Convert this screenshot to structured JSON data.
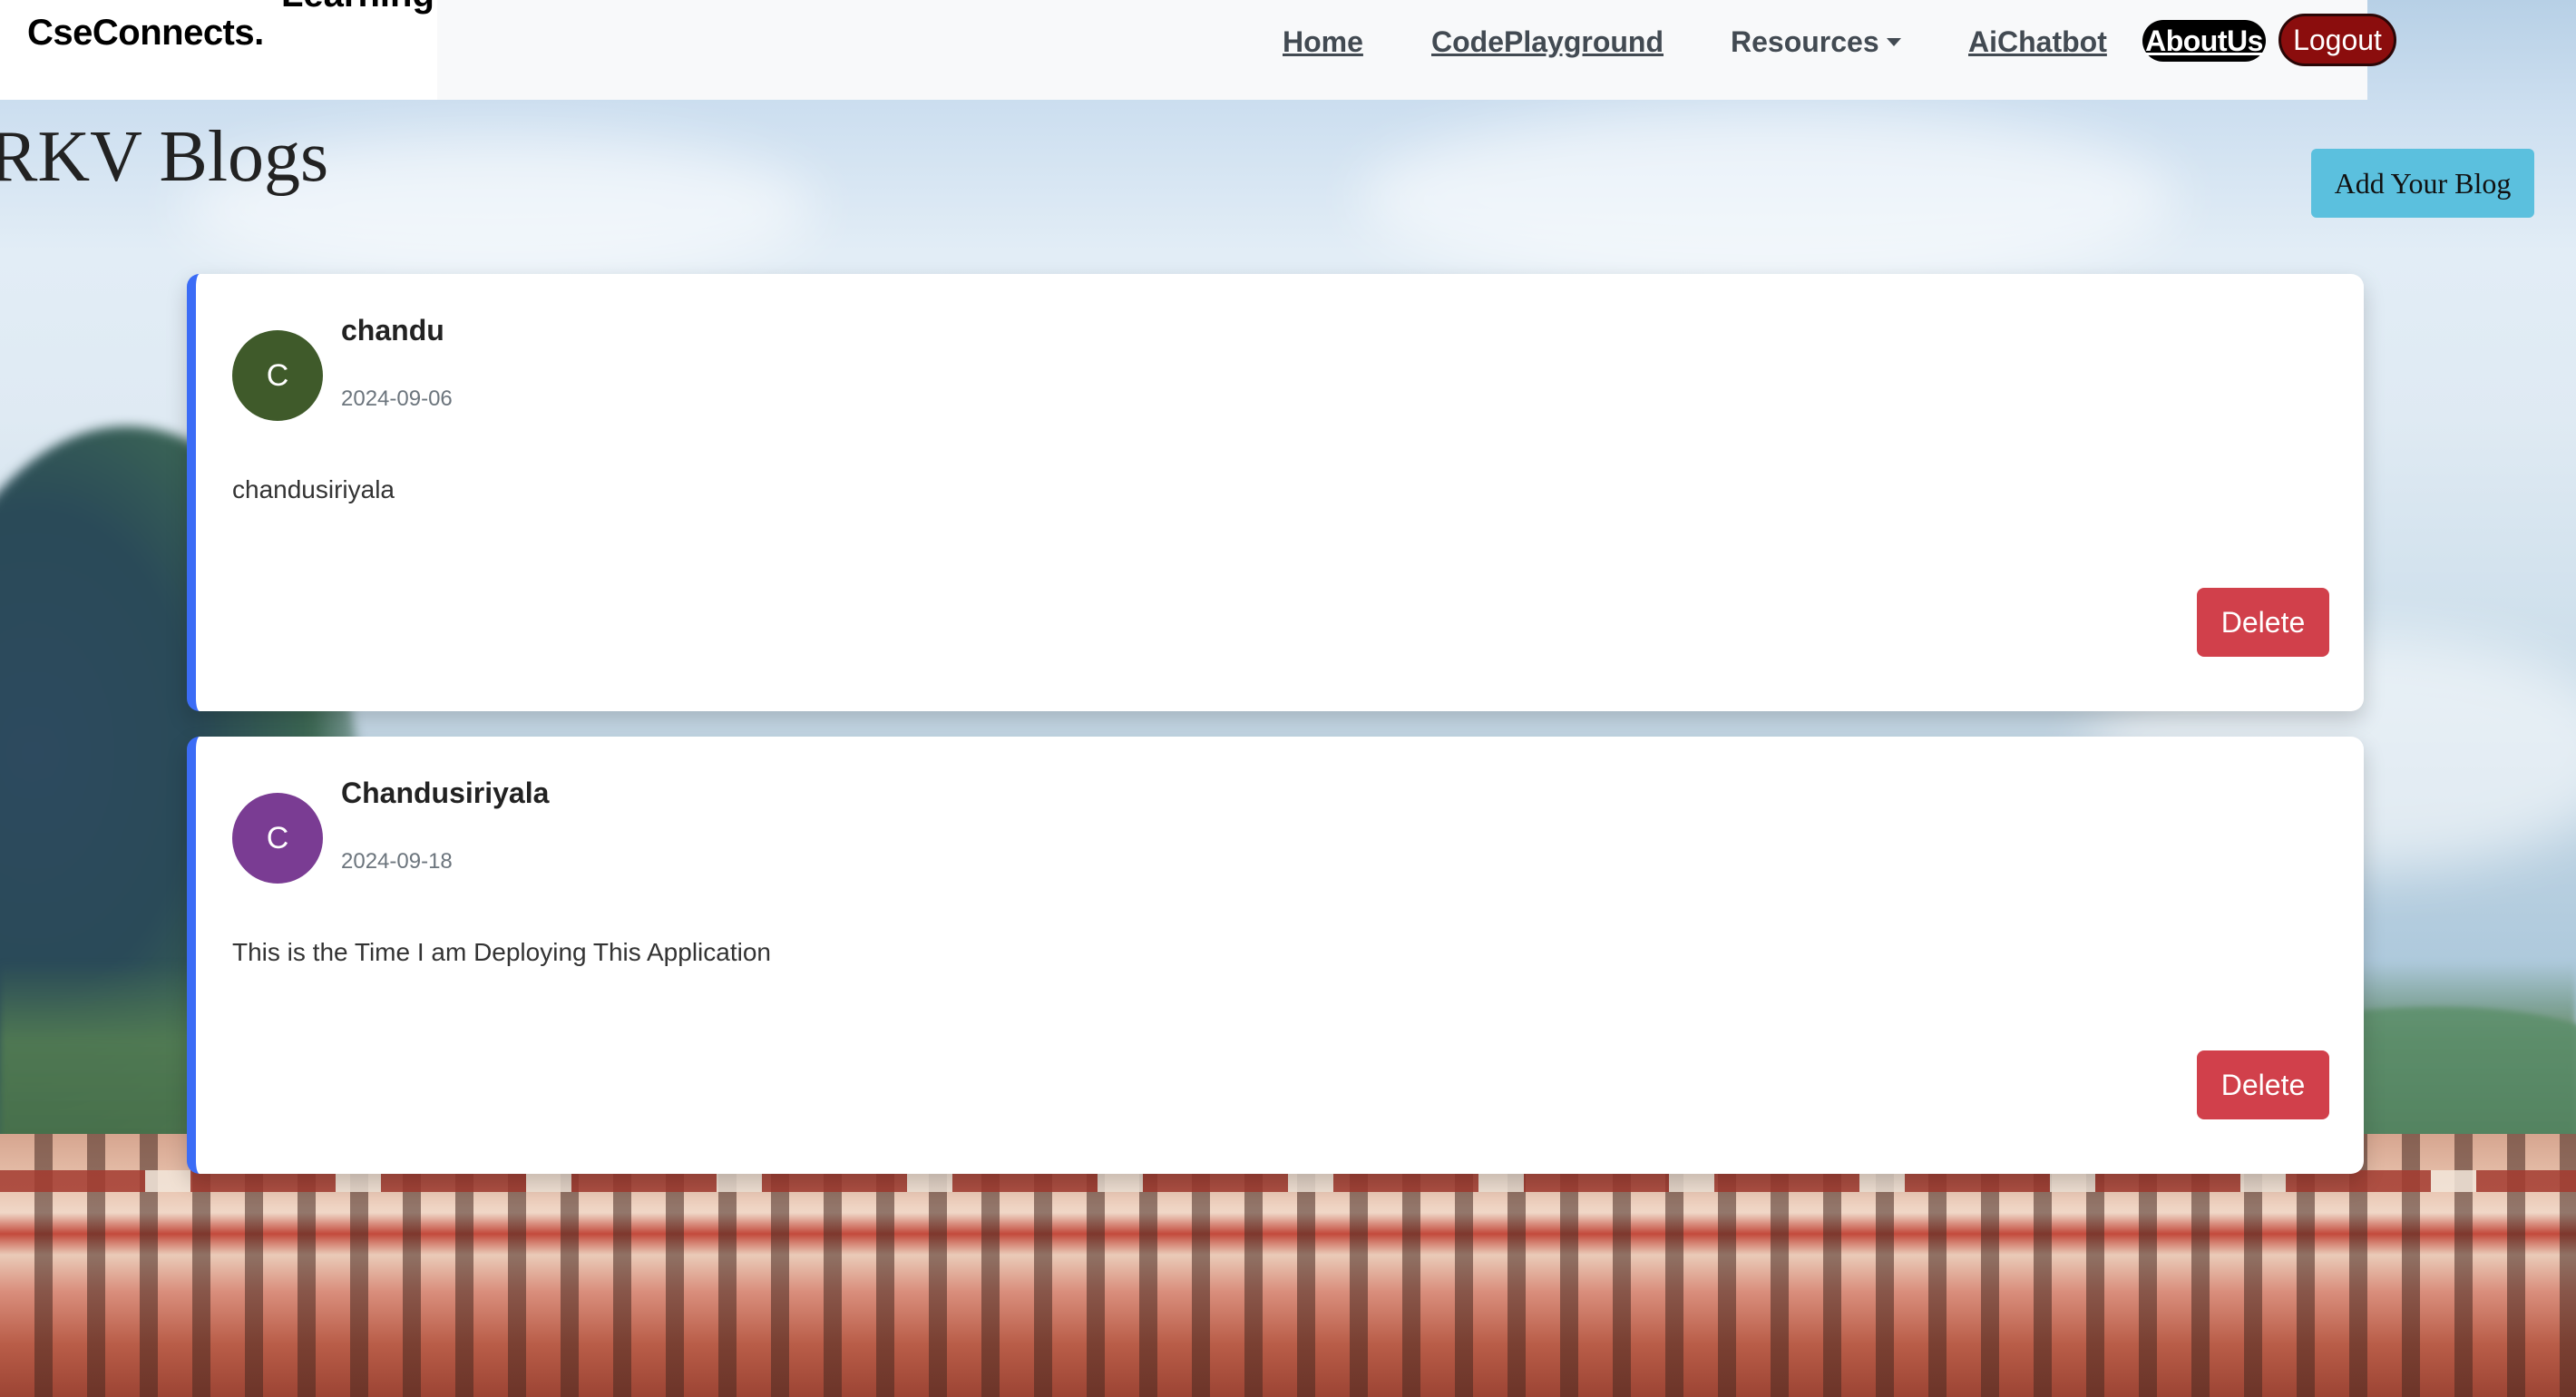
{
  "navbar": {
    "brand": "CseConnects.",
    "brand_sub": "Learning",
    "links": {
      "home": "Home",
      "code_playground": "CodePlayground",
      "resources": "Resources",
      "ai_chatbot": "AiChatbot",
      "about_us": "AboutUs",
      "logout": "Logout"
    }
  },
  "page": {
    "title": "RKV Blogs",
    "add_blog_label": "Add Your Blog"
  },
  "blogs": [
    {
      "author": "chandu",
      "initial": "C",
      "date": "2024-09-06",
      "content": "chandusiriyala",
      "delete_label": "Delete",
      "avatar_color": "#3f5a2a"
    },
    {
      "author": "Chandusiriyala",
      "initial": "C",
      "date": "2024-09-18",
      "content": "This is the Time I am Deploying This Application",
      "delete_label": "Delete",
      "avatar_color": "#7a3c93"
    }
  ],
  "colors": {
    "card_accent": "#3b6cf6",
    "delete_button": "#d1404b",
    "add_button": "#5bc0de",
    "logout_button": "#8b0d0d",
    "about_button": "#000000"
  },
  "icons": {
    "resources_dropdown": "caret-down-icon"
  }
}
